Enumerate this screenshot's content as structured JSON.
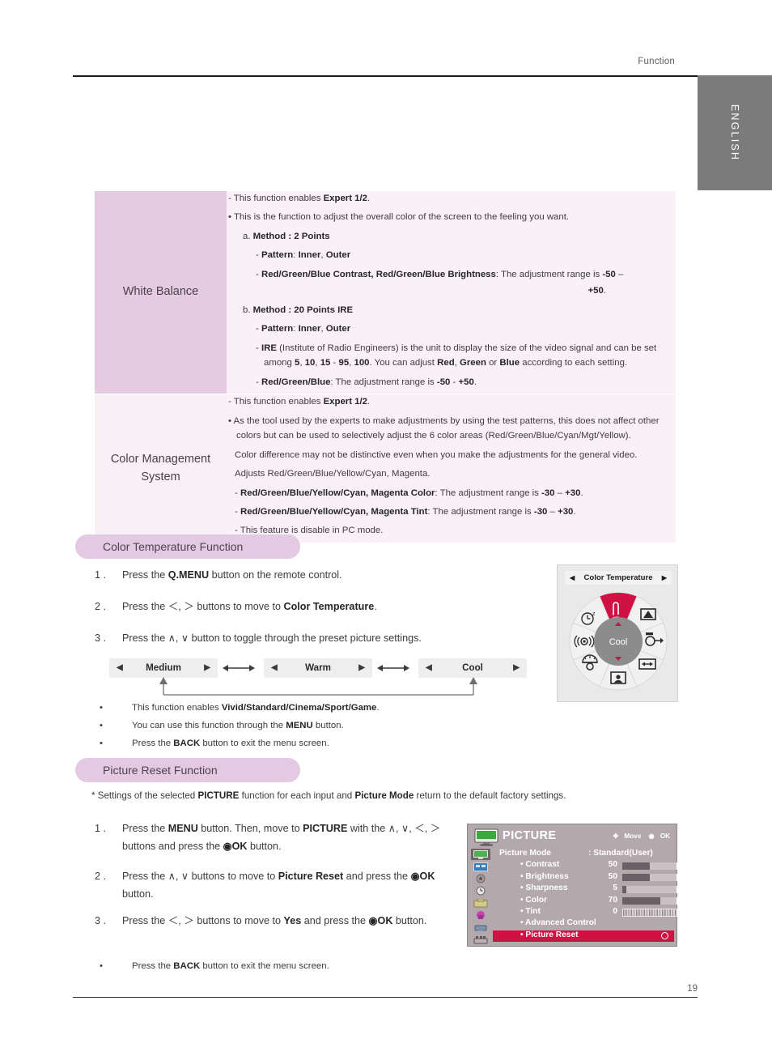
{
  "header": {
    "section_label": "Function",
    "language_tab": "ENGLISH"
  },
  "footer": {
    "page_number": "19"
  },
  "spec_table": {
    "rows": [
      {
        "label": "White Balance",
        "lines": {
          "l1a": "- This function enables ",
          "l1b": "Expert 1/2",
          "l1c": ".",
          "l2": "• This is the function to adjust the overall color of the screen to the feeling you want.",
          "l3a": "a. ",
          "l3b": "Method",
          "l3c": " : ",
          "l3d": "2 Points",
          "l4a": "- ",
          "l4b": "Pattern",
          "l4c": ": ",
          "l4d": "Inner",
          "l4e": ", ",
          "l4f": "Outer",
          "l5a": "- ",
          "l5b": "Red/Green/Blue Contrast, Red/Green/Blue Brightness",
          "l5c": ": The adjustment range is ",
          "l5d": "-50",
          "l5e": " – ",
          "l5f": "+50",
          "l5g": ".",
          "l6a": "b. ",
          "l6b": "Method",
          "l6c": " : ",
          "l6d": "20 Points IRE",
          "l7a": "- ",
          "l7b": "Pattern",
          "l7c": ": ",
          "l7d": "Inner",
          "l7e": ", ",
          "l7f": "Outer",
          "l8a": "- ",
          "l8b": "IRE",
          "l8c": " (Institute of Radio Engineers) is the unit to display the size of the video signal and can be set among ",
          "l8d": "5",
          "l8e": ", ",
          "l8f": "10",
          "l8g": ", ",
          "l8h": "15",
          "l8i": " - ",
          "l8j": "95",
          "l8k": ", ",
          "l8l": "100",
          "l8m": ". You can adjust ",
          "l8n": "Red",
          "l8o": ", ",
          "l8p": "Green",
          "l8q": " or ",
          "l8r": "Blue",
          "l8s": " according to each setting.",
          "l9a": "- ",
          "l9b": "Red/Green/Blue",
          "l9c": ": The adjustment range is ",
          "l9d": "-50",
          "l9e": " - ",
          "l9f": "+50",
          "l9g": "."
        }
      },
      {
        "label_line1": "Color Management",
        "label_line2": "System",
        "lines": {
          "m1a": "- This function enables ",
          "m1b": "Expert 1/2",
          "m1c": ".",
          "m2": "• As the tool used by the experts to make adjustments by using the test patterns, this does not affect other colors but can be used to selectively adjust the 6 color areas (Red/Green/Blue/Cyan/Mgt/Yellow).",
          "m3": "Color difference may not be distinctive even when you make the adjustments for the general video.",
          "m4": "Adjusts Red/Green/Blue/Yellow/Cyan, Magenta.",
          "m5a": "- ",
          "m5b": "Red/Green/Blue/Yellow/Cyan, Magenta Color",
          "m5c": ": The adjustment range is ",
          "m5d": "-30",
          "m5e": " – ",
          "m5f": "+30",
          "m5g": ".",
          "m6a": "- ",
          "m6b": "Red/Green/Blue/Yellow/Cyan, Magenta Tint",
          "m6c": ": The adjustment range is ",
          "m6d": "-30",
          "m6e": " – ",
          "m6f": "+30",
          "m6g": ".",
          "m7": "- This feature is disable in PC mode."
        }
      }
    ]
  },
  "color_temp_section": {
    "pill_label": "Color Temperature Function",
    "steps": [
      {
        "num": "1 .",
        "a": "Press the ",
        "b": "Q.MENU",
        "c": " button on the remote control."
      },
      {
        "num": "2 .",
        "a": "Press the ",
        "b": "＜, ＞",
        "c": " buttons to move to ",
        "d": "Color Temperature",
        "e": "."
      },
      {
        "num": "3 .",
        "a": "Press the ",
        "b": "∧,  ∨",
        "c": " button to toggle through the preset picture settings."
      }
    ],
    "selector": {
      "options": [
        "Medium",
        "Warm",
        "Cool"
      ],
      "left_arrow": "◀",
      "right_arrow": "▶"
    },
    "notes": [
      {
        "dot": "•",
        "a": "This function enables ",
        "b": "Vivid/Standard/Cinema/Sport/Game",
        "c": "."
      },
      {
        "dot": "•",
        "a": "You can use this function through the ",
        "b": "MENU",
        "c": " button."
      },
      {
        "dot": "•",
        "a": "Press the ",
        "b": "BACK",
        "c": " button to exit the menu screen."
      }
    ]
  },
  "qmenu_wheel": {
    "title": "Color Temperature",
    "left_arrow": "◀",
    "right_arrow": "▶",
    "center_value": "Cool",
    "selected_slice": "color-temperature",
    "highlight_color": "#cf1243",
    "segments": [
      "sleep-timer-icon",
      "aspect-ratio-icon",
      "input-icon",
      "wide-icon",
      "user-icon",
      "lamp-icon",
      "sound-icon",
      "color-temperature-icon"
    ],
    "thermometer_unit": "K"
  },
  "picture_reset_section": {
    "pill_label": "Picture Reset Function",
    "note": {
      "a": "* Settings of the selected ",
      "b": "PICTURE",
      "c": " function for each input and ",
      "d": "Picture Mode",
      "e": " return to the default factory settings."
    },
    "steps": [
      {
        "num": "1 .",
        "a": "Press the ",
        "b": "MENU",
        "c": " button. Then, move to ",
        "d": "PICTURE",
        "e": " with the ",
        "f": "∧, ∨, ＜, ＞",
        "g": " buttons and press the ",
        "h": "◉OK",
        "i": " button."
      },
      {
        "num": "2 .",
        "a": "Press the ",
        "b": "∧, ∨",
        "c": " buttons to move to ",
        "d": "Picture Reset",
        "e": " and press the ",
        "f": "◉OK",
        "g": " button."
      },
      {
        "num": "3 .",
        "a": "Press the ",
        "b": "＜, ＞",
        "c": " buttons to move to ",
        "d": "Yes",
        "e": " and press the ",
        "f": "◉OK",
        "g": " button."
      }
    ],
    "notes": [
      {
        "dot": "•",
        "a": "Press the ",
        "b": "BACK",
        "c": " button to exit the menu screen."
      }
    ]
  },
  "osd_menu": {
    "title": "PICTURE",
    "hint_move": "Move",
    "hint_ok": "OK",
    "accent_color": "#cf1243",
    "rows": [
      {
        "label": "Picture Mode",
        "value": ": Standard(User)",
        "indent": false,
        "type": "value"
      },
      {
        "label": "• Contrast",
        "number": "50",
        "bar_pct": 50,
        "indent": true,
        "type": "bar"
      },
      {
        "label": "• Brightness",
        "number": "50",
        "bar_pct": 50,
        "indent": true,
        "type": "bar"
      },
      {
        "label": "• Sharpness",
        "number": "5",
        "bar_pct": 8,
        "indent": true,
        "type": "bar"
      },
      {
        "label": "• Color",
        "number": "70",
        "bar_pct": 70,
        "indent": true,
        "type": "bar"
      },
      {
        "label": "• Tint",
        "number": "0",
        "indent": true,
        "type": "tick"
      },
      {
        "label": "• Advanced Control",
        "indent": true,
        "type": "plain"
      },
      {
        "label": "• Picture Reset",
        "indent": true,
        "type": "selected"
      }
    ],
    "sidebar_icons": [
      "picture-icon",
      "screen-icon",
      "audio-icon",
      "time-icon",
      "option-icon",
      "lock-icon",
      "network-icon",
      "usb-icon"
    ]
  }
}
